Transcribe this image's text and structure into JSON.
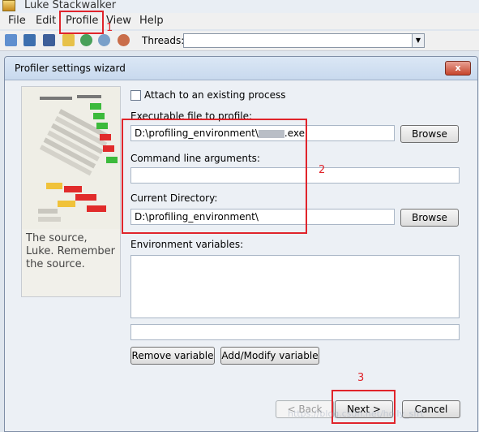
{
  "app": {
    "title": "Luke Stackwalker"
  },
  "menu": [
    "File",
    "Edit",
    "Profile",
    "View",
    "Help"
  ],
  "toolbar": {
    "threads_label": "Threads:",
    "threads_value": "",
    "icons": [
      "open-icon",
      "save-icon",
      "save-as-icon",
      "settings-icon",
      "run-icon",
      "zoom-in-icon",
      "zoom-out-icon"
    ]
  },
  "dialog": {
    "title": "Profiler settings wizard",
    "close": "x",
    "tagline": "The source, Luke. Remember the source.",
    "attach_label": "Attach to an existing process",
    "exe_label": "Executable file to profile:",
    "exe_value_prefix": "D:\\profiling_environment\\",
    "exe_value_suffix": ".exe",
    "browse": "Browse",
    "args_label": "Command line arguments:",
    "args_value": "",
    "dir_label": "Current Directory:",
    "dir_value": "D:\\profiling_environment\\",
    "env_label": "Environment variables:",
    "remove_variable": "Remove variable",
    "add_variable": "Add/Modify variable",
    "back": "< Back",
    "next": "Next >",
    "cancel": "Cancel"
  },
  "annotations": {
    "n1": "1",
    "n2": "2",
    "n3": "3"
  },
  "watermark": "https://blog.csdn.net/holly_sfrt"
}
